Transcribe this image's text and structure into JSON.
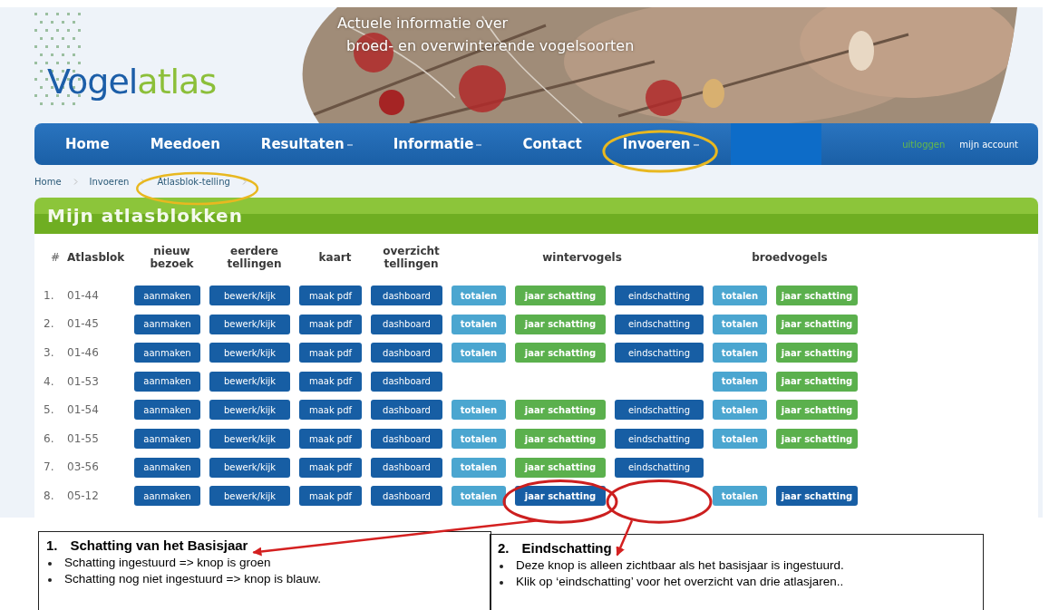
{
  "logo": {
    "part_1": "Vogel",
    "part_2": "atlas"
  },
  "tagline": [
    "Actuele informatie over",
    "broed- en overwinterende vogelsoorten"
  ],
  "nav": {
    "items": [
      {
        "label": "Home",
        "has_menu": false
      },
      {
        "label": "Meedoen",
        "has_menu": false
      },
      {
        "label": "Resultaten",
        "has_menu": true
      },
      {
        "label": "Informatie",
        "has_menu": true
      },
      {
        "label": "Contact",
        "has_menu": false
      },
      {
        "label": "Invoeren",
        "has_menu": true
      }
    ],
    "logout": "uitloggen",
    "account": "mijn account"
  },
  "breadcrumb": [
    "Home",
    "Invoeren",
    "Atlasblok-telling"
  ],
  "panel_title": "Mijn atlasblokken",
  "table": {
    "columns": [
      "#",
      "Atlasblok",
      "nieuw bezoek",
      "eerdere tellingen",
      "kaart",
      "overzicht tellingen"
    ],
    "groups": [
      "wintervogels",
      "broedvogels"
    ],
    "rows": [
      {
        "number": "1.",
        "atlasblok": "01-44",
        "actions": [
          "aanmaken",
          "bewerk/kijk",
          "maak pdf",
          "dashboard"
        ],
        "winter": {
          "totalen": "totalen",
          "jaar_schatting": {
            "label": "jaar schatting",
            "submitted": true
          },
          "eindschatting": "eindschatting"
        },
        "breeding": {
          "totalen": "totalen",
          "jaar_schatting": {
            "label": "jaar schatting",
            "submitted": true
          }
        }
      },
      {
        "number": "2.",
        "atlasblok": "01-45",
        "actions": [
          "aanmaken",
          "bewerk/kijk",
          "maak pdf",
          "dashboard"
        ],
        "winter": {
          "totalen": "totalen",
          "jaar_schatting": {
            "label": "jaar schatting",
            "submitted": true
          },
          "eindschatting": "eindschatting"
        },
        "breeding": {
          "totalen": "totalen",
          "jaar_schatting": {
            "label": "jaar schatting",
            "submitted": true
          }
        }
      },
      {
        "number": "3.",
        "atlasblok": "01-46",
        "actions": [
          "aanmaken",
          "bewerk/kijk",
          "maak pdf",
          "dashboard"
        ],
        "winter": {
          "totalen": "totalen",
          "jaar_schatting": {
            "label": "jaar schatting",
            "submitted": true
          },
          "eindschatting": "eindschatting"
        },
        "breeding": {
          "totalen": "totalen",
          "jaar_schatting": {
            "label": "jaar schatting",
            "submitted": true
          }
        }
      },
      {
        "number": "4.",
        "atlasblok": "01-53",
        "actions": [
          "aanmaken",
          "bewerk/kijk",
          "maak pdf",
          "dashboard"
        ],
        "breeding": {
          "totalen": "totalen",
          "jaar_schatting": {
            "label": "jaar schatting",
            "submitted": true
          }
        }
      },
      {
        "number": "5.",
        "atlasblok": "01-54",
        "actions": [
          "aanmaken",
          "bewerk/kijk",
          "maak pdf",
          "dashboard"
        ],
        "winter": {
          "totalen": "totalen",
          "jaar_schatting": {
            "label": "jaar schatting",
            "submitted": true
          },
          "eindschatting": "eindschatting"
        },
        "breeding": {
          "totalen": "totalen",
          "jaar_schatting": {
            "label": "jaar schatting",
            "submitted": true
          }
        }
      },
      {
        "number": "6.",
        "atlasblok": "01-55",
        "actions": [
          "aanmaken",
          "bewerk/kijk",
          "maak pdf",
          "dashboard"
        ],
        "winter": {
          "totalen": "totalen",
          "jaar_schatting": {
            "label": "jaar schatting",
            "submitted": true
          },
          "eindschatting": "eindschatting"
        },
        "breeding": {
          "totalen": "totalen",
          "jaar_schatting": {
            "label": "jaar schatting",
            "submitted": true
          }
        }
      },
      {
        "number": "7.",
        "atlasblok": "03-56",
        "actions": [
          "aanmaken",
          "bewerk/kijk",
          "maak pdf",
          "dashboard"
        ],
        "winter": {
          "totalen": "totalen",
          "jaar_schatting": {
            "label": "jaar schatting",
            "submitted": true
          },
          "eindschatting": "eindschatting"
        }
      },
      {
        "number": "8.",
        "atlasblok": "05-12",
        "actions": [
          "aanmaken",
          "bewerk/kijk",
          "maak pdf",
          "dashboard"
        ],
        "winter": {
          "totalen": "totalen",
          "jaar_schatting": {
            "label": "jaar schatting",
            "submitted": false
          }
        },
        "breeding": {
          "totalen": "totalen",
          "jaar_schatting": {
            "label": "jaar schatting",
            "submitted": false
          }
        }
      }
    ]
  },
  "notes": [
    {
      "number": "1.",
      "title": "Schatting van het Basisjaar",
      "bullets": [
        "Schatting ingestuurd => knop is groen",
        "Schatting nog niet ingestuurd => knop is blauw."
      ]
    },
    {
      "number": "2.",
      "title": "Eindschatting",
      "bullets": [
        "Deze knop is alleen zichtbaar als het basisjaar is ingestuurd.",
        "Klik op ‘eindschatting’ voor het overzicht van drie atlasjaren.."
      ]
    }
  ]
}
